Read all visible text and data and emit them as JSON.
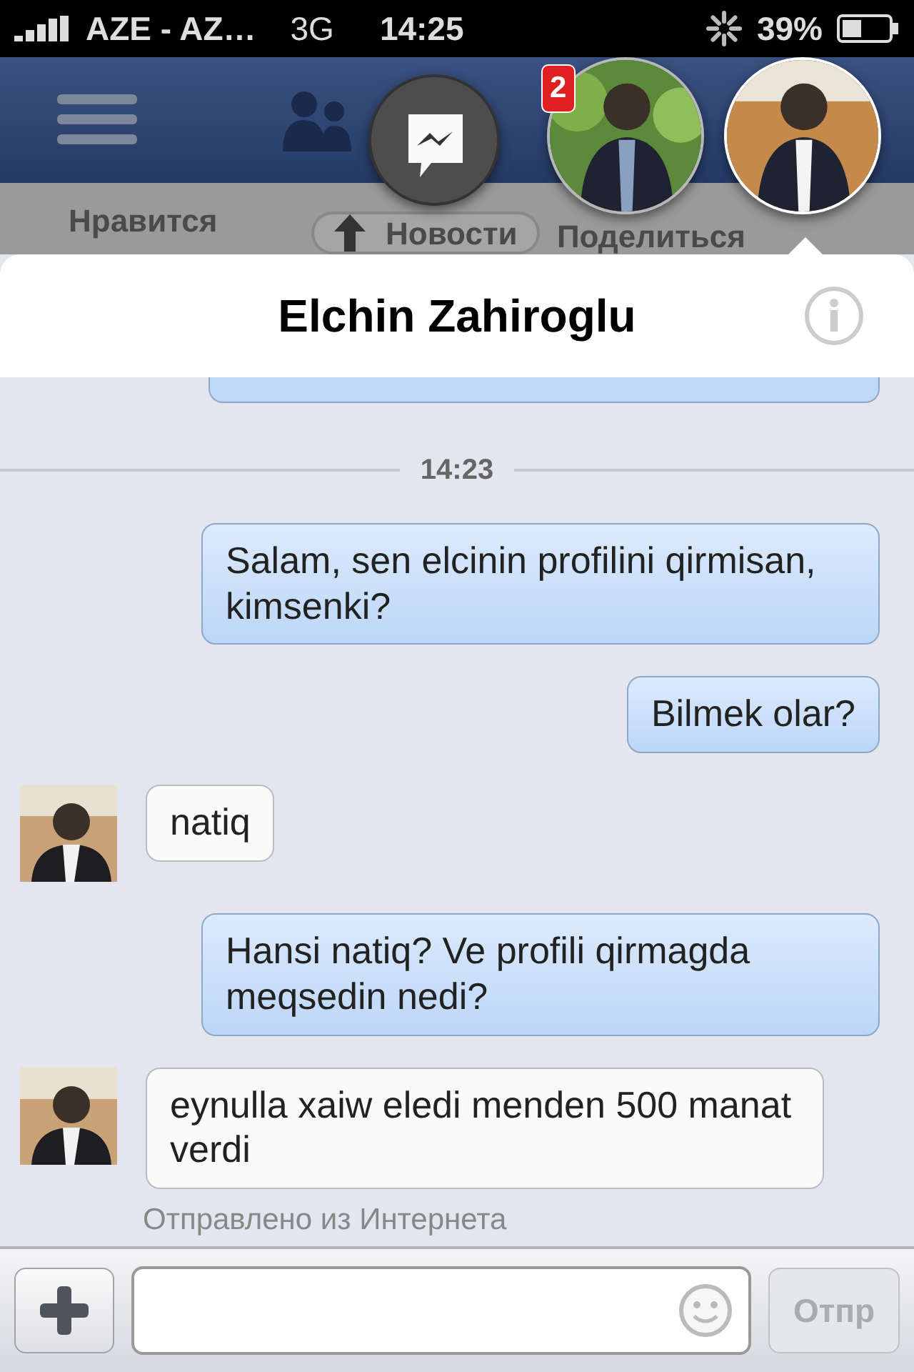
{
  "status_bar": {
    "carrier": "AZE - AZ…",
    "network": "3G",
    "time": "14:25",
    "battery": "39%"
  },
  "background_app": {
    "like": "Нравится",
    "news_button": "Новости",
    "share": "Поделиться"
  },
  "chat_heads": [
    {
      "kind": "messenger",
      "selected": false
    },
    {
      "kind": "avatar",
      "badge": "2",
      "selected": false
    },
    {
      "kind": "avatar",
      "selected": true
    }
  ],
  "conversation": {
    "title": "Elchin Zahiroglu",
    "messages": [
      {
        "kind": "partial"
      },
      {
        "kind": "time",
        "text": "14:23"
      },
      {
        "kind": "outgoing",
        "text": "Salam, sen elcinin profilini qirmisan, kimsenki?"
      },
      {
        "kind": "outgoing",
        "text": "Bilmek olar?"
      },
      {
        "kind": "incoming",
        "text": "natiq"
      },
      {
        "kind": "outgoing",
        "text": "Hansi natiq? Ve profili qirmagda meqsedin nedi?"
      },
      {
        "kind": "incoming",
        "text": "eynulla xaiw eledi menden 500 manat verdi"
      }
    ],
    "footer_note": "Отправлено из Интернета"
  },
  "composer": {
    "send": "Отпр",
    "send_disabled": true
  }
}
